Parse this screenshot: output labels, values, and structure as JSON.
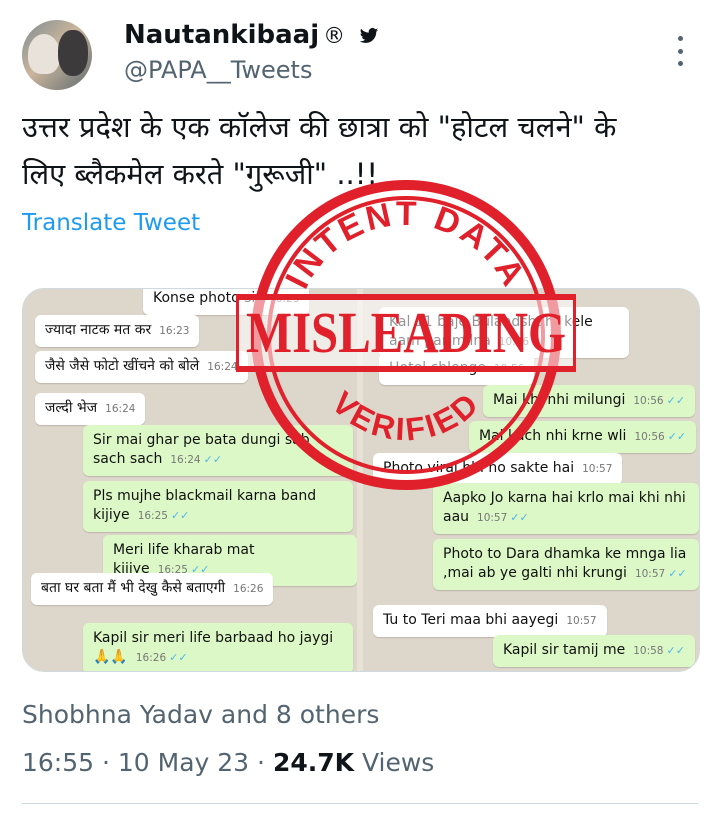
{
  "author": {
    "name": "Nautankibaaj",
    "registered": "®",
    "handle": "@PAPA__Tweets"
  },
  "tweet": {
    "line1": "उत्तर प्रदेश के एक कॉलेज की छात्रा को \"होटल चलने\" के",
    "line2": "लिए ब्लैकमेल करते \"गुरूजी\" ..!!",
    "translate": "Translate Tweet"
  },
  "chat_left": [
    {
      "dir": "in",
      "text": "Konse photo sir",
      "time": "16:23"
    },
    {
      "dir": "in",
      "text": "ज्यादा नाटक मत कर",
      "time": "16:23"
    },
    {
      "dir": "in",
      "text": "जैसे जैसे फोटो खींचने को बोले",
      "time": "16:24"
    },
    {
      "dir": "in",
      "text": "जल्दी भेज",
      "time": "16:24"
    },
    {
      "dir": "out",
      "text": "Sir mai ghar pe bata dungi sab sach sach",
      "time": "16:24"
    },
    {
      "dir": "out",
      "text": "Pls mujhe blackmail karna band kijiye",
      "time": "16:25"
    },
    {
      "dir": "out",
      "text": "Meri life kharab mat kijiye",
      "time": "16:25"
    },
    {
      "dir": "in",
      "text": "बता घर बता मैं भी देखु कैसे बताएगी",
      "time": "16:26"
    },
    {
      "dir": "out",
      "text": "Kapil sir meri life barbaad ho jaygi🙏🙏",
      "time": "16:26"
    }
  ],
  "chat_right": [
    {
      "dir": "in",
      "text": "Kal 11 baje Bulandshahr kele aam par milna",
      "time": "10:56"
    },
    {
      "dir": "in",
      "text": "Hotel chlenge",
      "time": "10:56"
    },
    {
      "dir": "out",
      "text": "Mai khi nhi milungi",
      "time": "10:56"
    },
    {
      "dir": "out",
      "text": "Mai kuch nhi krne wli",
      "time": "10:56"
    },
    {
      "dir": "in",
      "text": "Photo viral bhi ho sakte hai",
      "time": "10:57"
    },
    {
      "dir": "out",
      "text": "Aapko Jo karna hai krlo mai khi nhi aau",
      "time": "10:57"
    },
    {
      "dir": "out",
      "text": "Photo to Dara dhamka ke mnga lia ,mai ab ye galti nhi krungi",
      "time": "10:57"
    },
    {
      "dir": "in",
      "text": "Tu to Teri maa bhi aayegi",
      "time": "10:57"
    },
    {
      "dir": "out",
      "text": "Kapil sir tamij me",
      "time": "10:58"
    }
  ],
  "stamp": {
    "top": "INTENT DATA",
    "middle": "MISLEADING",
    "bottom": "VERIFIED",
    "color": "#e0202a"
  },
  "engagement": {
    "liked_by": "Shobhna Yadav and 8 others",
    "time": "16:55",
    "date": "10 May 23",
    "views_count": "24.7K",
    "views_label": "Views"
  },
  "icons": [
    "twitter-bird-icon",
    "more-options-icon"
  ]
}
